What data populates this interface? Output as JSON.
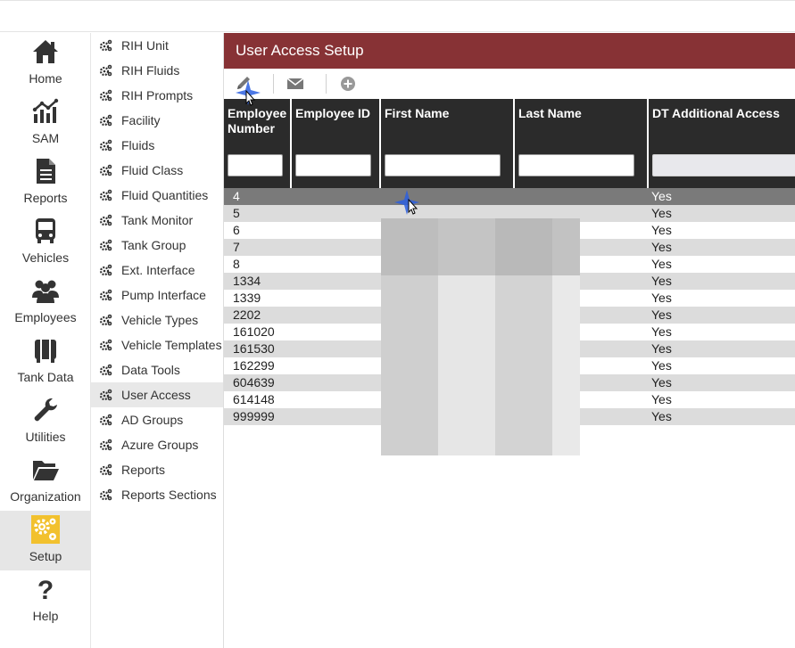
{
  "nav": {
    "items": [
      {
        "label": "Home",
        "icon": "home-icon"
      },
      {
        "label": "SAM",
        "icon": "chart-line-icon"
      },
      {
        "label": "Reports",
        "icon": "document-icon"
      },
      {
        "label": "Vehicles",
        "icon": "bus-icon"
      },
      {
        "label": "Employees",
        "icon": "people-icon"
      },
      {
        "label": "Tank Data",
        "icon": "tank-icon"
      },
      {
        "label": "Utilities",
        "icon": "wrench-icon"
      },
      {
        "label": "Organization",
        "icon": "folder-open-icon"
      },
      {
        "label": "Setup",
        "icon": "gears-icon",
        "active": true
      },
      {
        "label": "Help",
        "icon": "question-icon"
      }
    ]
  },
  "submenu": {
    "items": [
      "RIH Unit",
      "RIH Fluids",
      "RIH Prompts",
      "Facility",
      "Fluids",
      "Fluid Class",
      "Fluid Quantities",
      "Tank Monitor",
      "Tank Group",
      "Ext. Interface",
      "Pump Interface",
      "Vehicle Types",
      "Vehicle Templates",
      "Data Tools",
      "User Access",
      "AD Groups",
      "Azure Groups",
      "Reports",
      "Reports Sections"
    ],
    "active": "User Access"
  },
  "page": {
    "title": "User Access Setup"
  },
  "toolbar": {
    "edit_icon": "pencil-icon",
    "email_icon": "envelope-icon",
    "add_icon": "plus-circle-icon"
  },
  "grid": {
    "columns": [
      {
        "header_line1": "Employee",
        "header_line2": "Number"
      },
      {
        "header_line1": "Employee ID",
        "header_line2": ""
      },
      {
        "header_line1": "First Name",
        "header_line2": ""
      },
      {
        "header_line1": "Last Name",
        "header_line2": ""
      },
      {
        "header_line1": "DT Additional Access",
        "header_line2": ""
      }
    ],
    "rows": [
      {
        "employee_number": "4",
        "additional_access": "Yes"
      },
      {
        "employee_number": "5",
        "additional_access": "Yes"
      },
      {
        "employee_number": "6",
        "additional_access": "Yes"
      },
      {
        "employee_number": "7",
        "additional_access": "Yes"
      },
      {
        "employee_number": "8",
        "additional_access": "Yes"
      },
      {
        "employee_number": "1334",
        "additional_access": "Yes"
      },
      {
        "employee_number": "1339",
        "additional_access": "Yes"
      },
      {
        "employee_number": "2202",
        "additional_access": "Yes"
      },
      {
        "employee_number": "161020",
        "additional_access": "Yes"
      },
      {
        "employee_number": "161530",
        "additional_access": "Yes"
      },
      {
        "employee_number": "162299",
        "additional_access": "Yes"
      },
      {
        "employee_number": "604639",
        "additional_access": "Yes"
      },
      {
        "employee_number": "614148",
        "additional_access": "Yes"
      },
      {
        "employee_number": "999999",
        "additional_access": "Yes"
      }
    ],
    "selected_row": 0
  },
  "colors": {
    "title_bar": "#873235",
    "header_bg": "#2b2b2b",
    "selected_row": "#7a7a7a",
    "alt_row": "#dcdcdc",
    "setup_icon": "#f2c12e"
  }
}
